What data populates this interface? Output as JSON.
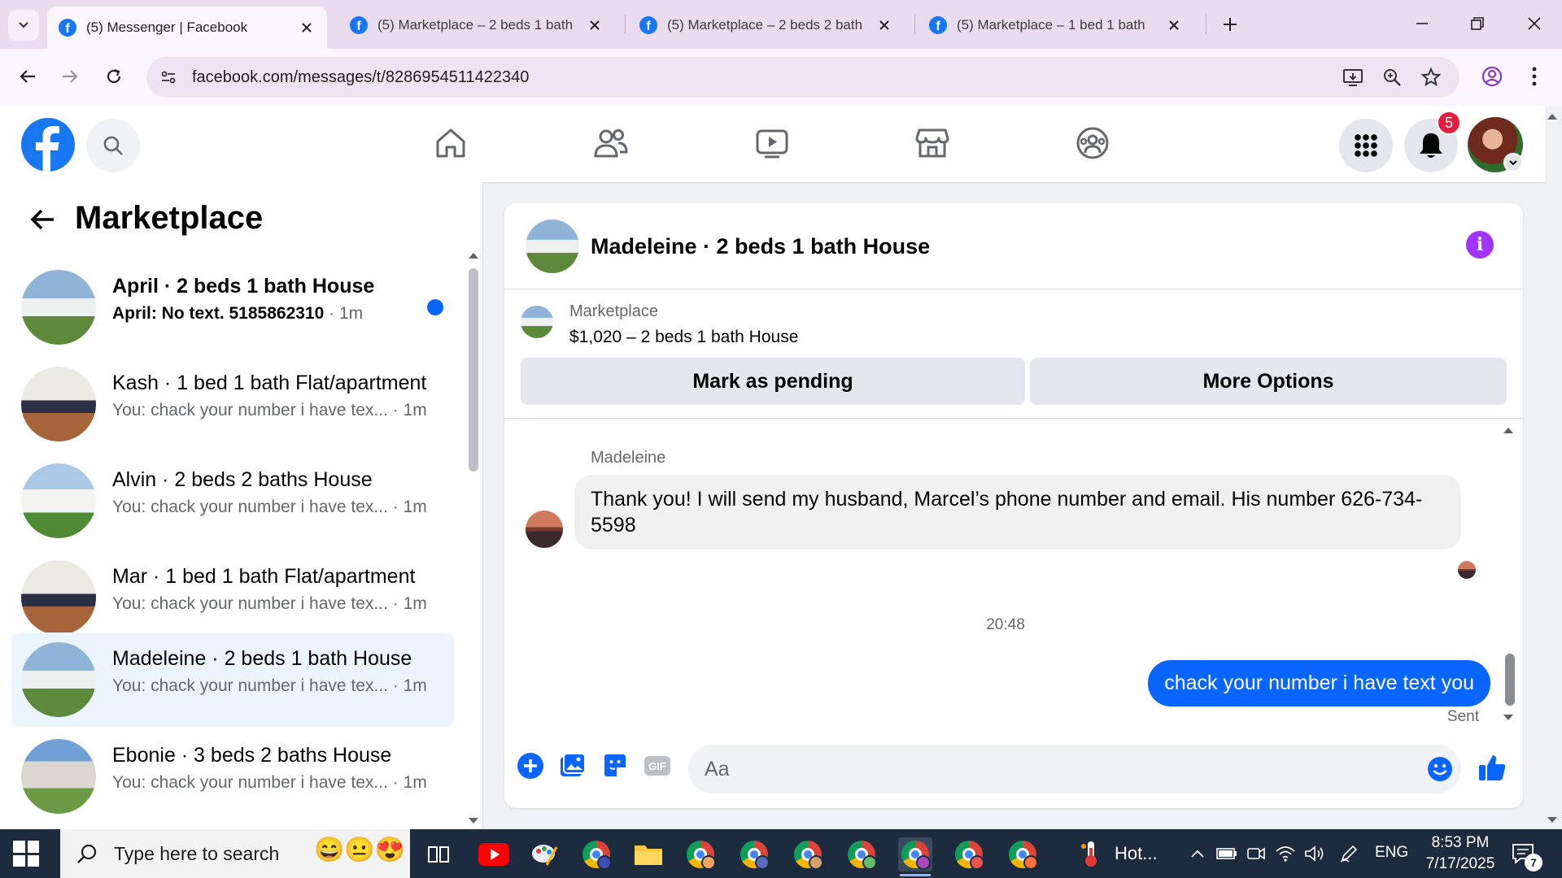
{
  "browser": {
    "tabs": [
      {
        "title": "(5) Messenger | Facebook",
        "active": true
      },
      {
        "title": "(5) Marketplace – 2 beds 1 bath",
        "active": false
      },
      {
        "title": "(5) Marketplace – 2 beds 2 bath",
        "active": false
      },
      {
        "title": "(5) Marketplace – 1 bed 1 bath",
        "active": false
      }
    ],
    "url": "facebook.com/messages/t/8286954511422340"
  },
  "fb_nav": {
    "notification_count": "5"
  },
  "left_panel": {
    "title": "Marketplace",
    "conversations": [
      {
        "title": "April · 2 beds 1 bath House",
        "preview": "April: No text. 5185862310",
        "time": "· 1m",
        "unread": true
      },
      {
        "title": "Kash · 1 bed 1 bath Flat/apartment",
        "preview": "You: chack your number i have tex...",
        "time": "· 1m",
        "unread": false
      },
      {
        "title": "Alvin · 2 beds 2 baths House",
        "preview": "You: chack your number i have tex...",
        "time": "· 1m",
        "unread": false
      },
      {
        "title": "Mar · 1 bed 1 bath Flat/apartment",
        "preview": "You: chack your number i have tex...",
        "time": "· 1m",
        "unread": false
      },
      {
        "title": "Madeleine · 2 beds 1 bath House",
        "preview": "You: chack your number i have tex...",
        "time": "· 1m",
        "unread": false,
        "selected": true
      },
      {
        "title": "Ebonie · 3 beds 2 baths House",
        "preview": "You: chack your number i have tex...",
        "time": "· 1m",
        "unread": false
      }
    ]
  },
  "chat": {
    "title": "Madeleine · 2 beds 1 bath House",
    "marketplace_label": "Marketplace",
    "listing": "$1,020 – 2 beds 1 bath House",
    "mark_pending_label": "Mark as pending",
    "more_options_label": "More Options",
    "incoming": {
      "sender": "Madeleine",
      "text": "Thank you! I will send my husband, Marcel’s phone number and email. His number 626-734-5598"
    },
    "timestamp": "20:48",
    "outgoing": {
      "text": "chack your number i have text you",
      "status": "Sent"
    },
    "composer_placeholder": "Aa"
  },
  "taskbar": {
    "search_placeholder": "Type here to search",
    "weather_text": "Hot...",
    "language": "ENG",
    "time": "8:53 PM",
    "date": "7/17/2025",
    "notification_count": "7"
  },
  "colors": {
    "facebook_blue": "#1877f2",
    "messenger_blue": "#0866ff",
    "selected_row": "#ebf5ff",
    "info_purple": "#a033ff",
    "badge_red": "#e41e3f"
  }
}
